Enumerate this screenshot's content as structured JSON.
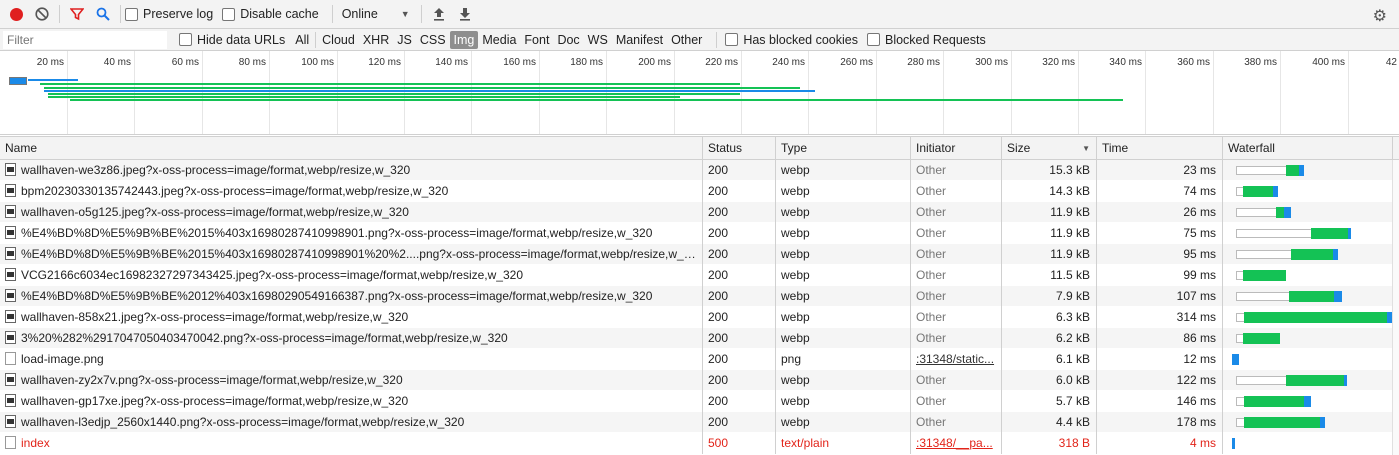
{
  "toolbar": {
    "preserve_log": "Preserve log",
    "disable_cache": "Disable cache",
    "throttling": "Online"
  },
  "filterbar": {
    "filter_placeholder": "Filter",
    "hide_data_urls": "Hide data URLs",
    "types": [
      "All",
      "Cloud",
      "XHR",
      "JS",
      "CSS",
      "Img",
      "Media",
      "Font",
      "Doc",
      "WS",
      "Manifest",
      "Other"
    ],
    "active_type": "Img",
    "has_blocked_cookies": "Has blocked cookies",
    "blocked_requests": "Blocked Requests"
  },
  "overview": {
    "ticks": [
      "20 ms",
      "40 ms",
      "60 ms",
      "80 ms",
      "100 ms",
      "120 ms",
      "140 ms",
      "160 ms",
      "180 ms",
      "200 ms",
      "220 ms",
      "240 ms",
      "260 ms",
      "280 ms",
      "300 ms",
      "320 ms",
      "340 ms",
      "360 ms",
      "380 ms",
      "400 ms",
      "42"
    ]
  },
  "columns": {
    "name": "Name",
    "status": "Status",
    "type": "Type",
    "initiator": "Initiator",
    "size": "Size",
    "time": "Time",
    "waterfall": "Waterfall"
  },
  "rows": [
    {
      "name": "wallhaven-we3z86.jpeg?x-oss-process=image/format,webp/resize,w_320",
      "status": "200",
      "type": "webp",
      "initiator": "Other",
      "size": "15.3 kB",
      "time": "23 ms",
      "wf": {
        "wait": 0.3,
        "recv": 0.08,
        "dl": 0.03
      }
    },
    {
      "name": "bpm20230330135742443.jpeg?x-oss-process=image/format,webp/resize,w_320",
      "status": "200",
      "type": "webp",
      "initiator": "Other",
      "size": "14.3 kB",
      "time": "74 ms",
      "wf": {
        "wait": 0.04,
        "recv": 0.18,
        "dl": 0.03
      }
    },
    {
      "name": "wallhaven-o5g125.jpeg?x-oss-process=image/format,webp/resize,w_320",
      "status": "200",
      "type": "webp",
      "initiator": "Other",
      "size": "11.9 kB",
      "time": "26 ms",
      "wf": {
        "wait": 0.24,
        "recv": 0.05,
        "dl": 0.04
      }
    },
    {
      "name": "%E4%BD%8D%E5%9B%BE%2015%403x16980287410998901.png?x-oss-process=image/format,webp/resize,w_320",
      "status": "200",
      "type": "webp",
      "initiator": "Other",
      "size": "11.9 kB",
      "time": "75 ms",
      "wf": {
        "wait": 0.45,
        "recv": 0.22,
        "dl": 0.02
      }
    },
    {
      "name": "%E4%BD%8D%E5%9B%BE%2015%403x16980287410998901%20%2....png?x-oss-process=image/format,webp/resize,w_320",
      "status": "200",
      "type": "webp",
      "initiator": "Other",
      "size": "11.9 kB",
      "time": "95 ms",
      "wf": {
        "wait": 0.33,
        "recv": 0.25,
        "dl": 0.03
      }
    },
    {
      "name": "VCG2166c6034ec16982327297343425.jpeg?x-oss-process=image/format,webp/resize,w_320",
      "status": "200",
      "type": "webp",
      "initiator": "Other",
      "size": "11.5 kB",
      "time": "99 ms",
      "wf": {
        "wait": 0.04,
        "recv": 0.26,
        "dl": 0.0
      }
    },
    {
      "name": "%E4%BD%8D%E5%9B%BE%2012%403x16980290549166387.png?x-oss-process=image/format,webp/resize,w_320",
      "status": "200",
      "type": "webp",
      "initiator": "Other",
      "size": "7.9 kB",
      "time": "107 ms",
      "wf": {
        "wait": 0.32,
        "recv": 0.27,
        "dl": 0.05
      }
    },
    {
      "name": "wallhaven-858x21.jpeg?x-oss-process=image/format,webp/resize,w_320",
      "status": "200",
      "type": "webp",
      "initiator": "Other",
      "size": "6.3 kB",
      "time": "314 ms",
      "wf": {
        "wait": 0.05,
        "recv": 0.86,
        "dl": 0.03
      }
    },
    {
      "name": "3%20%282%2917047050403470042.png?x-oss-process=image/format,webp/resize,w_320",
      "status": "200",
      "type": "webp",
      "initiator": "Other",
      "size": "6.2 kB",
      "time": "86 ms",
      "wf": {
        "wait": 0.04,
        "recv": 0.22,
        "dl": 0.0
      }
    },
    {
      "name": "load-image.png",
      "status": "200",
      "type": "png",
      "initiator": ":31348/static...",
      "size": "6.1 kB",
      "time": "12 ms",
      "wf": {
        "wait": 0.0,
        "recv": 0.0,
        "dl": 0.04
      }
    },
    {
      "name": "wallhaven-zy2x7v.png?x-oss-process=image/format,webp/resize,w_320",
      "status": "200",
      "type": "webp",
      "initiator": "Other",
      "size": "6.0 kB",
      "time": "122 ms",
      "wf": {
        "wait": 0.3,
        "recv": 0.35,
        "dl": 0.02
      }
    },
    {
      "name": "wallhaven-gp17xe.jpeg?x-oss-process=image/format,webp/resize,w_320",
      "status": "200",
      "type": "webp",
      "initiator": "Other",
      "size": "5.7 kB",
      "time": "146 ms",
      "wf": {
        "wait": 0.05,
        "recv": 0.36,
        "dl": 0.04
      }
    },
    {
      "name": "wallhaven-l3edjp_2560x1440.png?x-oss-process=image/format,webp/resize,w_320",
      "status": "200",
      "type": "webp",
      "initiator": "Other",
      "size": "4.4 kB",
      "time": "178 ms",
      "wf": {
        "wait": 0.05,
        "recv": 0.46,
        "dl": 0.03
      }
    },
    {
      "name": "index",
      "status": "500",
      "type": "text/plain",
      "initiator": ":31348/__pa...",
      "size": "318 B",
      "time": "4 ms",
      "error": true,
      "wf": {
        "wait": 0.0,
        "recv": 0.0,
        "dl": 0.02
      }
    }
  ],
  "colors": {
    "record": "#e01f1f",
    "waterfall_download": "#14c255",
    "waterfall_receive": "#1a8ae8",
    "error_text": "#e2241a"
  }
}
